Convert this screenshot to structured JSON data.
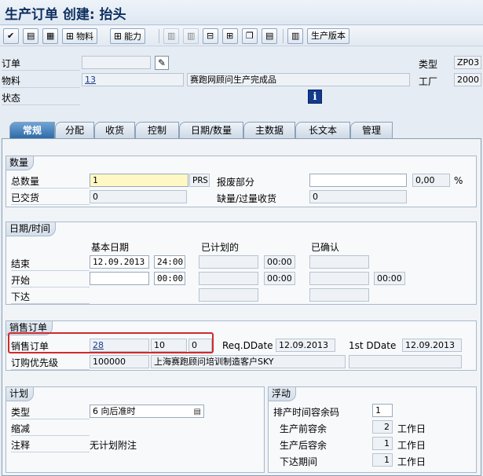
{
  "title": "生产订单 创建: 抬头",
  "toolbar": {
    "material_label": "物料",
    "capacity_label": "能力",
    "version_label": "生产版本"
  },
  "header": {
    "order_label": "订单",
    "material_label": "物料",
    "status_label": "状态",
    "type_label": "类型",
    "plant_label": "工厂",
    "order_value": "",
    "material_value": "13",
    "material_desc": "赛跑网顾问生产完成品",
    "type_value": "ZP03",
    "plant_value": "2000"
  },
  "tabs": [
    "常规",
    "分配",
    "收货",
    "控制",
    "日期/数量",
    "主数据",
    "长文本",
    "管理"
  ],
  "quantity": {
    "title": "数量",
    "total_label": "总数量",
    "total_value": "1",
    "unit": "PRS",
    "scrap_label": "报废部分",
    "scrap_value": "",
    "scrap_pct": "0,00",
    "pct_sign": "%",
    "delivered_label": "已交货",
    "delivered_value": "0",
    "shortage_label": "缺量/过量收货",
    "shortage_value": "0"
  },
  "dates": {
    "title": "日期/时间",
    "col_basic": "基本日期",
    "col_scheduled": "已计划的",
    "col_confirmed": "已确认",
    "end_label": "结束",
    "start_label": "开始",
    "release_label": "下达",
    "end_date": "12.09.2013",
    "end_time": "24:00",
    "end_sched_time": "00:00",
    "start_date": "",
    "start_time": "00:00",
    "start_sched_time": "00:00",
    "start_conf_time": "00:00"
  },
  "sales": {
    "title": "销售订单",
    "so_label": "销售订单",
    "so_value": "28",
    "so_item": "10",
    "so_sched": "0",
    "req_label": "Req.DDate",
    "req_value": "12.09.2013",
    "first_label": "1st DDate",
    "first_value": "12.09.2013",
    "prio_label": "订购优先级",
    "prio_value": "100000",
    "customer": "上海赛跑顾问培训制造客户SKY"
  },
  "plan": {
    "title": "计划",
    "type_label": "类型",
    "type_value": "6 向后准时",
    "reduce_label": "缩减",
    "note_label": "注释",
    "note_value": "无计划附注"
  },
  "float": {
    "title": "浮动",
    "sched_margin_label": "排产时间容余码",
    "sched_margin_value": "1",
    "before_label": "生产前容余",
    "before_value": "2",
    "after_label": "生产后容余",
    "after_value": "1",
    "release_label": "下达期间",
    "release_value": "1",
    "workday": "工作日"
  },
  "colors": {
    "title": "#0d2f5e",
    "active_tab": "#2f6aa6",
    "highlight": "#d12a2a"
  }
}
